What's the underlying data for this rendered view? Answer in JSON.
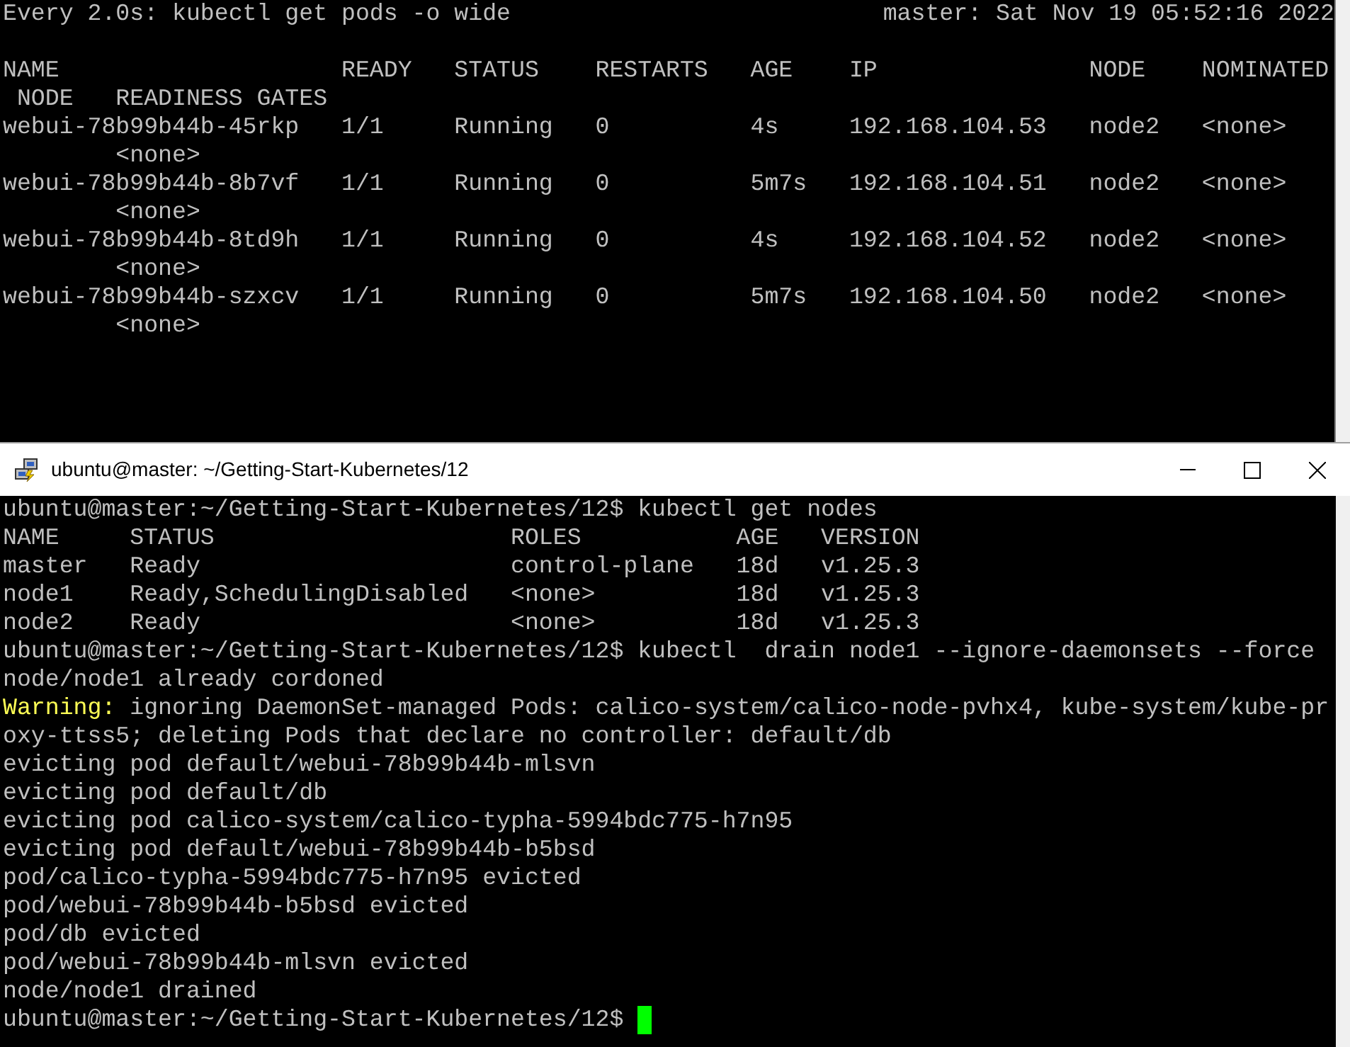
{
  "watch_terminal": {
    "header": {
      "command": "Every 2.0s: kubectl get pods -o wide",
      "host_time": "master: Sat Nov 19 05:52:16 2022"
    },
    "lines": [
      "NAME                    READY   STATUS    RESTARTS   AGE    IP               NODE    NOMINATED",
      " NODE   READINESS GATES",
      "webui-78b99b44b-45rkp   1/1     Running   0          4s     192.168.104.53   node2   <none>",
      "        <none>",
      "webui-78b99b44b-8b7vf   1/1     Running   0          5m7s   192.168.104.51   node2   <none>",
      "        <none>",
      "webui-78b99b44b-8td9h   1/1     Running   0          4s     192.168.104.52   node2   <none>",
      "        <none>",
      "webui-78b99b44b-szxcv   1/1     Running   0          5m7s   192.168.104.50   node2   <none>",
      "        <none>"
    ]
  },
  "terminal_window": {
    "title": "ubuntu@master: ~/Getting-Start-Kubernetes/12",
    "lines": [
      {
        "kind": "plain",
        "text": "ubuntu@master:~/Getting-Start-Kubernetes/12$ kubectl get nodes"
      },
      {
        "kind": "plain",
        "text": "NAME     STATUS                     ROLES           AGE   VERSION"
      },
      {
        "kind": "plain",
        "text": "master   Ready                      control-plane   18d   v1.25.3"
      },
      {
        "kind": "plain",
        "text": "node1    Ready,SchedulingDisabled   <none>          18d   v1.25.3"
      },
      {
        "kind": "plain",
        "text": "node2    Ready                      <none>          18d   v1.25.3"
      },
      {
        "kind": "plain",
        "text": "ubuntu@master:~/Getting-Start-Kubernetes/12$ kubectl  drain node1 --ignore-daemonsets --force"
      },
      {
        "kind": "plain",
        "text": "node/node1 already cordoned"
      },
      {
        "kind": "warning",
        "label": "Warning:",
        "text": " ignoring DaemonSet-managed Pods: calico-system/calico-node-pvhx4, kube-system/kube-pr"
      },
      {
        "kind": "plain",
        "text": "oxy-ttss5; deleting Pods that declare no controller: default/db"
      },
      {
        "kind": "plain",
        "text": "evicting pod default/webui-78b99b44b-mlsvn"
      },
      {
        "kind": "plain",
        "text": "evicting pod default/db"
      },
      {
        "kind": "plain",
        "text": "evicting pod calico-system/calico-typha-5994bdc775-h7n95"
      },
      {
        "kind": "plain",
        "text": "evicting pod default/webui-78b99b44b-b5bsd"
      },
      {
        "kind": "plain",
        "text": "pod/calico-typha-5994bdc775-h7n95 evicted"
      },
      {
        "kind": "plain",
        "text": "pod/webui-78b99b44b-b5bsd evicted"
      },
      {
        "kind": "plain",
        "text": "pod/db evicted"
      },
      {
        "kind": "plain",
        "text": "pod/webui-78b99b44b-mlsvn evicted"
      },
      {
        "kind": "plain",
        "text": "node/node1 drained"
      }
    ],
    "prompt": "ubuntu@master:~/Getting-Start-Kubernetes/12$"
  }
}
